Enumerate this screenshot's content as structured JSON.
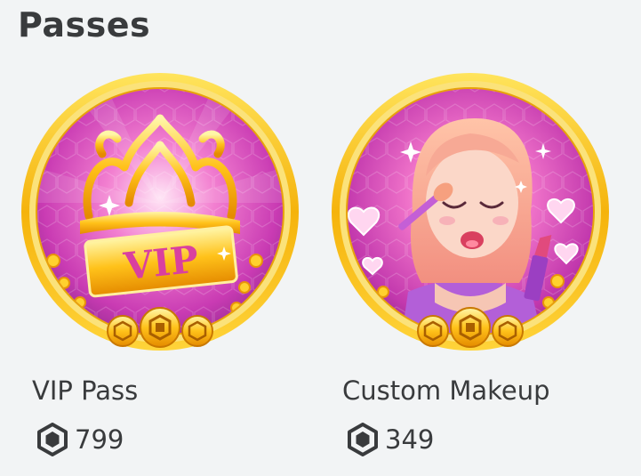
{
  "section": {
    "title": "Passes"
  },
  "passes": [
    {
      "name": "VIP Pass",
      "price": "799",
      "price_icon": "robux-icon",
      "image_icon": "vip-crown-icon",
      "badge_text": "VIP"
    },
    {
      "name": "Custom Makeup",
      "price": "349",
      "price_icon": "robux-icon",
      "image_icon": "makeup-character-icon"
    }
  ],
  "colors": {
    "text": "#393b3d",
    "background": "#f2f4f5",
    "ring_gold": "#f5c016",
    "badge_pink": "#d9409f"
  }
}
